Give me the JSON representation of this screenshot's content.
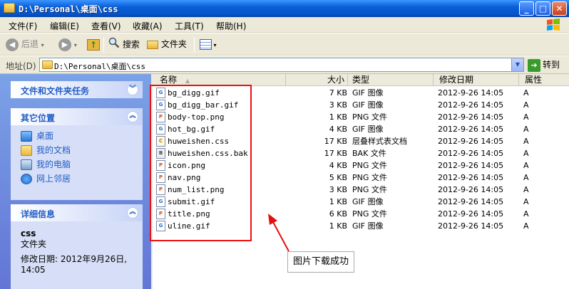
{
  "window": {
    "title": "D:\\Personal\\桌面\\css"
  },
  "menu": [
    "文件(F)",
    "编辑(E)",
    "查看(V)",
    "收藏(A)",
    "工具(T)",
    "帮助(H)"
  ],
  "toolbar": {
    "back": "后退",
    "search": "搜索",
    "folders": "文件夹"
  },
  "address": {
    "label": "地址(D)",
    "path": "D:\\Personal\\桌面\\css",
    "go": "转到"
  },
  "sidebar": {
    "tasks_title": "文件和文件夹任务",
    "places_title": "其它位置",
    "places": [
      {
        "label": "桌面",
        "icon": "desktop-icon"
      },
      {
        "label": "我的文档",
        "icon": "my-documents-icon"
      },
      {
        "label": "我的电脑",
        "icon": "my-computer-icon"
      },
      {
        "label": "网上邻居",
        "icon": "network-icon"
      }
    ],
    "details_title": "详细信息",
    "details": {
      "name": "css",
      "type": "文件夹",
      "modified": "修改日期: 2012年9月26日, 14:05"
    }
  },
  "columns": {
    "name": "名称",
    "size": "大小",
    "type": "类型",
    "date": "修改日期",
    "attr": "属性"
  },
  "files": [
    {
      "name": "bg_digg.gif",
      "size": "7 KB",
      "type": "GIF 图像",
      "date": "2012-9-26 14:05",
      "attr": "A",
      "icon": "gif-icon"
    },
    {
      "name": "bg_digg_bar.gif",
      "size": "3 KB",
      "type": "GIF 图像",
      "date": "2012-9-26 14:05",
      "attr": "A",
      "icon": "gif-icon"
    },
    {
      "name": "body-top.png",
      "size": "1 KB",
      "type": "PNG 文件",
      "date": "2012-9-26 14:05",
      "attr": "A",
      "icon": "png-icon"
    },
    {
      "name": "hot_bg.gif",
      "size": "4 KB",
      "type": "GIF 图像",
      "date": "2012-9-26 14:05",
      "attr": "A",
      "icon": "gif-icon"
    },
    {
      "name": "huweishen.css",
      "size": "17 KB",
      "type": "层叠样式表文档",
      "date": "2012-9-26 14:05",
      "attr": "A",
      "icon": "css-icon"
    },
    {
      "name": "huweishen.css.bak",
      "size": "17 KB",
      "type": "BAK 文件",
      "date": "2012-9-26 14:05",
      "attr": "A",
      "icon": "bak-icon"
    },
    {
      "name": "icon.png",
      "size": "4 KB",
      "type": "PNG 文件",
      "date": "2012-9-26 14:05",
      "attr": "A",
      "icon": "png-icon"
    },
    {
      "name": "nav.png",
      "size": "5 KB",
      "type": "PNG 文件",
      "date": "2012-9-26 14:05",
      "attr": "A",
      "icon": "png-icon"
    },
    {
      "name": "num_list.png",
      "size": "3 KB",
      "type": "PNG 文件",
      "date": "2012-9-26 14:05",
      "attr": "A",
      "icon": "png-icon"
    },
    {
      "name": "submit.gif",
      "size": "1 KB",
      "type": "GIF 图像",
      "date": "2012-9-26 14:05",
      "attr": "A",
      "icon": "gif-icon"
    },
    {
      "name": "title.png",
      "size": "6 KB",
      "type": "PNG 文件",
      "date": "2012-9-26 14:05",
      "attr": "A",
      "icon": "png-icon"
    },
    {
      "name": "uline.gif",
      "size": "1 KB",
      "type": "GIF 图像",
      "date": "2012-9-26 14:05",
      "attr": "A",
      "icon": "gif-icon"
    }
  ],
  "annotation": {
    "text": "图片下载成功",
    "color": "#e11111"
  },
  "colors": {
    "titlebar": "#0553c8",
    "sidebar": "#6f8ee0",
    "link": "#215dc6"
  }
}
